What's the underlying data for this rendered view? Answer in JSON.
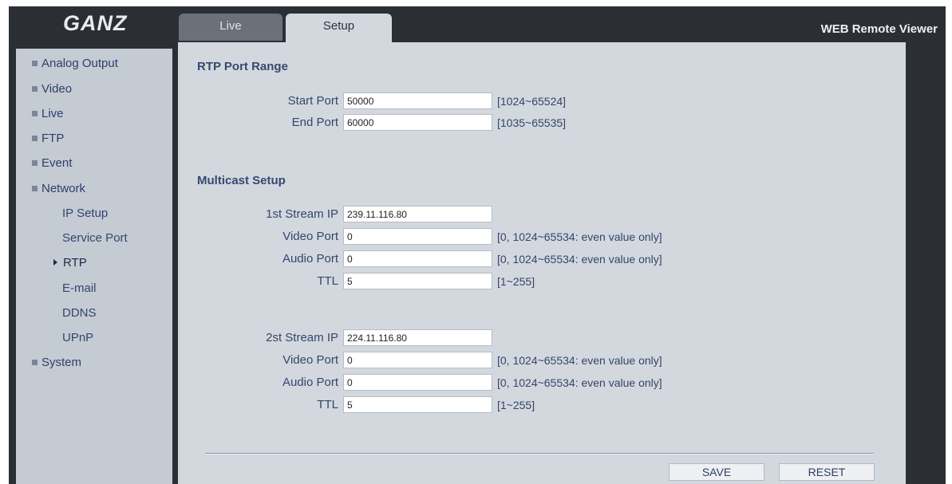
{
  "header": {
    "logo": "GANZ",
    "viewer_title": "WEB Remote Viewer",
    "tabs": [
      {
        "label": "Live",
        "active": false
      },
      {
        "label": "Setup",
        "active": true
      }
    ]
  },
  "sidebar": {
    "items": [
      {
        "label": "Analog Output"
      },
      {
        "label": "Video"
      },
      {
        "label": "Live"
      },
      {
        "label": "FTP"
      },
      {
        "label": "Event"
      },
      {
        "label": "Network"
      },
      {
        "label": "System"
      }
    ],
    "network_sub": [
      {
        "label": "IP Setup"
      },
      {
        "label": "Service Port"
      },
      {
        "label": "RTP",
        "active": true
      },
      {
        "label": "E-mail"
      },
      {
        "label": "DDNS"
      },
      {
        "label": "UPnP"
      }
    ]
  },
  "rtp": {
    "title": "RTP Port Range",
    "start_label": "Start Port",
    "start_value": "50000",
    "start_hint": "[1024~65524]",
    "end_label": "End Port",
    "end_value": "60000",
    "end_hint": "[1035~65535]"
  },
  "multicast": {
    "title": "Multicast Setup",
    "stream1": {
      "ip_label": "1st Stream IP",
      "ip_value": "239.11.116.80",
      "video_label": "Video Port",
      "video_value": "0",
      "video_hint": "[0, 1024~65534: even value only]",
      "audio_label": "Audio Port",
      "audio_value": "0",
      "audio_hint": "[0, 1024~65534: even value only]",
      "ttl_label": "TTL",
      "ttl_value": "5",
      "ttl_hint": "[1~255]"
    },
    "stream2": {
      "ip_label": "2st Stream IP",
      "ip_value": "224.11.116.80",
      "video_label": "Video Port",
      "video_value": "0",
      "video_hint": "[0, 1024~65534: even value only]",
      "audio_label": "Audio Port",
      "audio_value": "0",
      "audio_hint": "[0, 1024~65534: even value only]",
      "ttl_label": "TTL",
      "ttl_value": "5",
      "ttl_hint": "[1~255]"
    }
  },
  "actions": {
    "save_label": "SAVE",
    "reset_label": "RESET"
  },
  "colors": {
    "frame_dark": "#2b2f35",
    "panel": "#d3d8df",
    "sidebar": "#c5cbd3",
    "link_text": "#2d3f6a"
  }
}
